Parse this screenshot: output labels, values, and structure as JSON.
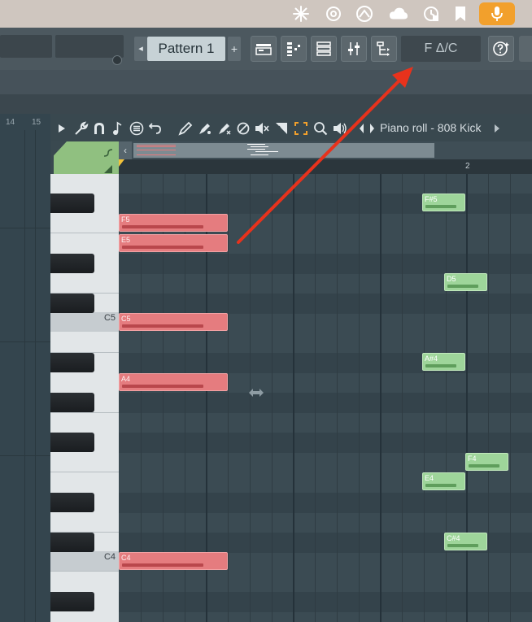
{
  "toolbar": {
    "pattern_label": "Pattern 1",
    "pattern_add": "+",
    "pattern_prev": "◂",
    "chord_display": "F Δ/C"
  },
  "channel_strip": {
    "numbers": [
      "14",
      "15"
    ]
  },
  "piano_roll": {
    "title": "Piano roll - 808 Kick",
    "bar_marker": "2",
    "key_labels": {
      "c5": "C5",
      "c4": "C4"
    }
  },
  "notes": {
    "red": [
      {
        "label": "F5"
      },
      {
        "label": "E5"
      },
      {
        "label": "C5"
      },
      {
        "label": "A4"
      },
      {
        "label": "C4"
      }
    ],
    "green": [
      {
        "label": "F#5"
      },
      {
        "label": "D5"
      },
      {
        "label": "A#4"
      },
      {
        "label": "F4"
      },
      {
        "label": "E4"
      },
      {
        "label": "C#4"
      }
    ]
  },
  "colors": {
    "mic_accent": "#f2a02c",
    "red_note": "#e57c7f",
    "green_note": "#9ed59a",
    "annotation_arrow": "#e8321c"
  },
  "icons": {
    "menubar": [
      "sparkle-icon",
      "openai-icon",
      "arc-icon",
      "creative-cloud-icon",
      "time-machine-icon",
      "bookmark-icon",
      "microphone-icon"
    ],
    "toolbar": [
      "playlist-icon",
      "step-sequencer-icon",
      "channel-rack-icon",
      "mixer-icon",
      "browser-icon",
      "help-chat-icon"
    ],
    "piano_roll_tools": [
      "play-arrow-icon",
      "wrench-icon",
      "magnet-icon",
      "note-icon",
      "menu-icon",
      "undo-icon",
      "pencil-icon",
      "paint-icon",
      "paint-brush-icon",
      "delete-icon",
      "mute-icon",
      "slice-icon",
      "select-icon",
      "zoom-icon",
      "audition-icon",
      "scroll-icon"
    ]
  }
}
